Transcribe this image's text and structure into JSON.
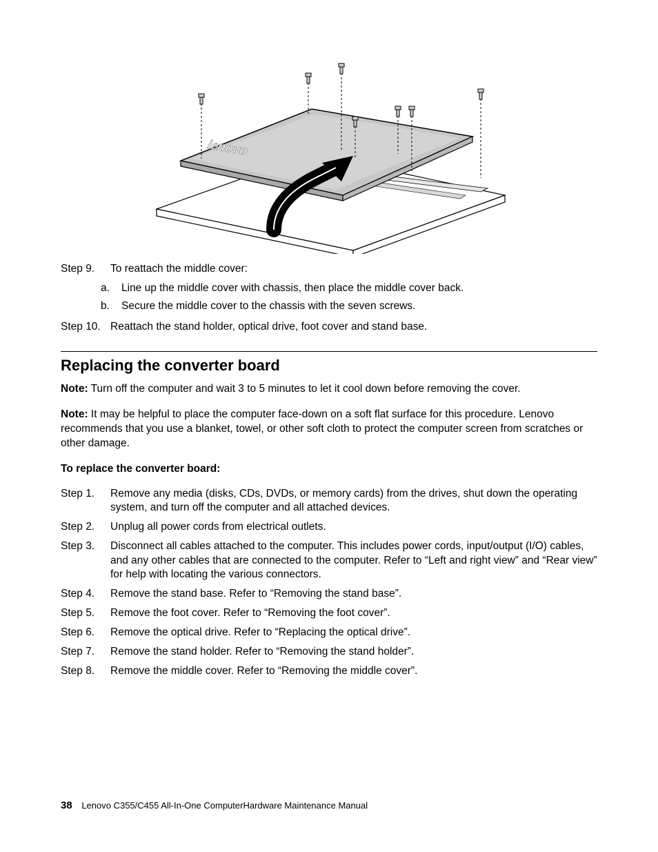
{
  "figure": {
    "logo_text": "lenovo"
  },
  "top_steps": [
    {
      "label": "Step 9.",
      "text": "To reattach the middle cover:",
      "subs": [
        {
          "label": "a.",
          "text": "Line up the middle cover with chassis, then place the middle cover back."
        },
        {
          "label": "b.",
          "text": "Secure the middle cover to the chassis with the seven screws."
        }
      ]
    },
    {
      "label": "Step 10.",
      "text": "Reattach the stand holder, optical drive, foot cover and stand base.",
      "subs": []
    }
  ],
  "section_title": "Replacing the converter board",
  "notes": [
    {
      "label": "Note:",
      "text": "Turn off the computer and wait 3 to 5 minutes to let it cool down before removing the cover."
    },
    {
      "label": "Note:",
      "text": "It may be helpful to place the computer face-down on a soft flat surface for this procedure. Lenovo recommends that you use a blanket, towel, or other soft cloth to protect the computer screen from scratches or other damage."
    }
  ],
  "subhead": "To replace the converter board:",
  "steps": [
    {
      "label": "Step 1.",
      "text": "Remove any media (disks, CDs, DVDs, or memory cards) from the drives, shut down the operating system, and turn off the computer and all attached devices."
    },
    {
      "label": "Step 2.",
      "text": "Unplug all power cords from electrical outlets."
    },
    {
      "label": "Step 3.",
      "text": "Disconnect all cables attached to the computer. This includes power cords, input/output (I/O) cables, and any other cables that are connected to the computer. Refer to “Left and right view” and “Rear view” for help with locating the various connectors."
    },
    {
      "label": "Step 4.",
      "text": "Remove the stand base. Refer to “Removing the stand base”."
    },
    {
      "label": "Step 5.",
      "text": "Remove the foot cover. Refer to “Removing the foot cover”."
    },
    {
      "label": "Step 6.",
      "text": "Remove the optical drive. Refer to “Replacing the optical drive”."
    },
    {
      "label": "Step 7.",
      "text": "Remove the stand holder. Refer to “Removing the stand holder”."
    },
    {
      "label": "Step 8.",
      "text": "Remove the middle cover. Refer to “Removing the middle cover”."
    }
  ],
  "footer": {
    "page": "38",
    "title": "Lenovo C355/C455 All-In-One ComputerHardware Maintenance Manual"
  }
}
